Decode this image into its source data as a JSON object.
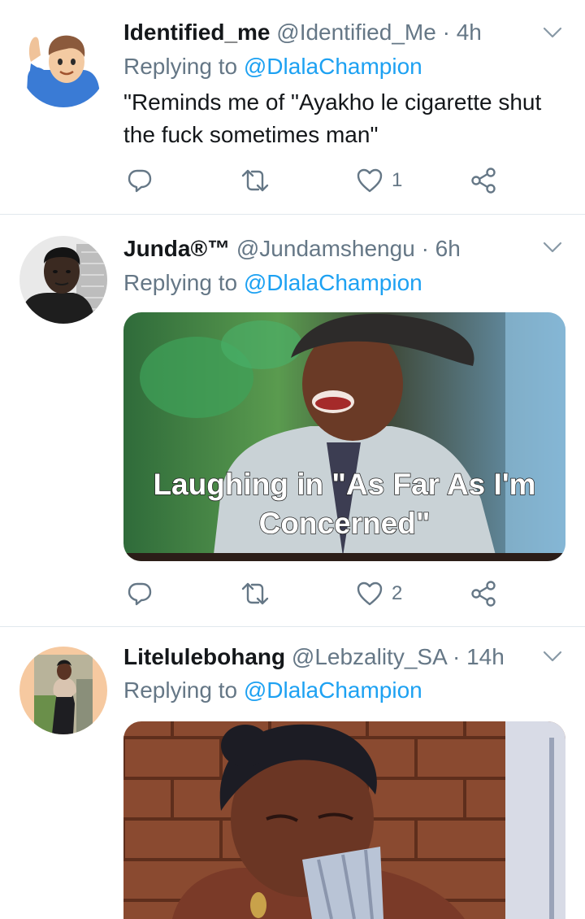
{
  "tweets": [
    {
      "name": "Identified_me",
      "handle": "@Identified_Me",
      "separator": "·",
      "time": "4h",
      "replying_prefix": "Replying to ",
      "replying_to": "@DlalaChampion",
      "text": "\"Reminds me of \"Ayakho le cigarette shut the fuck sometimes man\"",
      "counts": {
        "reply": "",
        "retweet": "",
        "like": "1"
      }
    },
    {
      "name": "Junda®™",
      "handle": "@Jundamshengu",
      "separator": "·",
      "time": "6h",
      "replying_prefix": "Replying to ",
      "replying_to": "@DlalaChampion",
      "media_caption": [
        "Laughing in \"As Far As I'm",
        "Concerned\""
      ],
      "counts": {
        "reply": "",
        "retweet": "",
        "like": "2"
      }
    },
    {
      "name": "Litelulebohang",
      "handle": "@Lebzality_SA",
      "separator": "·",
      "time": "14h",
      "replying_prefix": "Replying to ",
      "replying_to": "@DlalaChampion"
    }
  ],
  "colors": {
    "link": "#1da1f2",
    "secondary_text": "#657786",
    "primary_text": "#14171a",
    "divider": "#e1e8ed"
  },
  "icons": [
    "chevron-down-icon",
    "reply-icon",
    "retweet-icon",
    "like-icon",
    "share-icon"
  ]
}
